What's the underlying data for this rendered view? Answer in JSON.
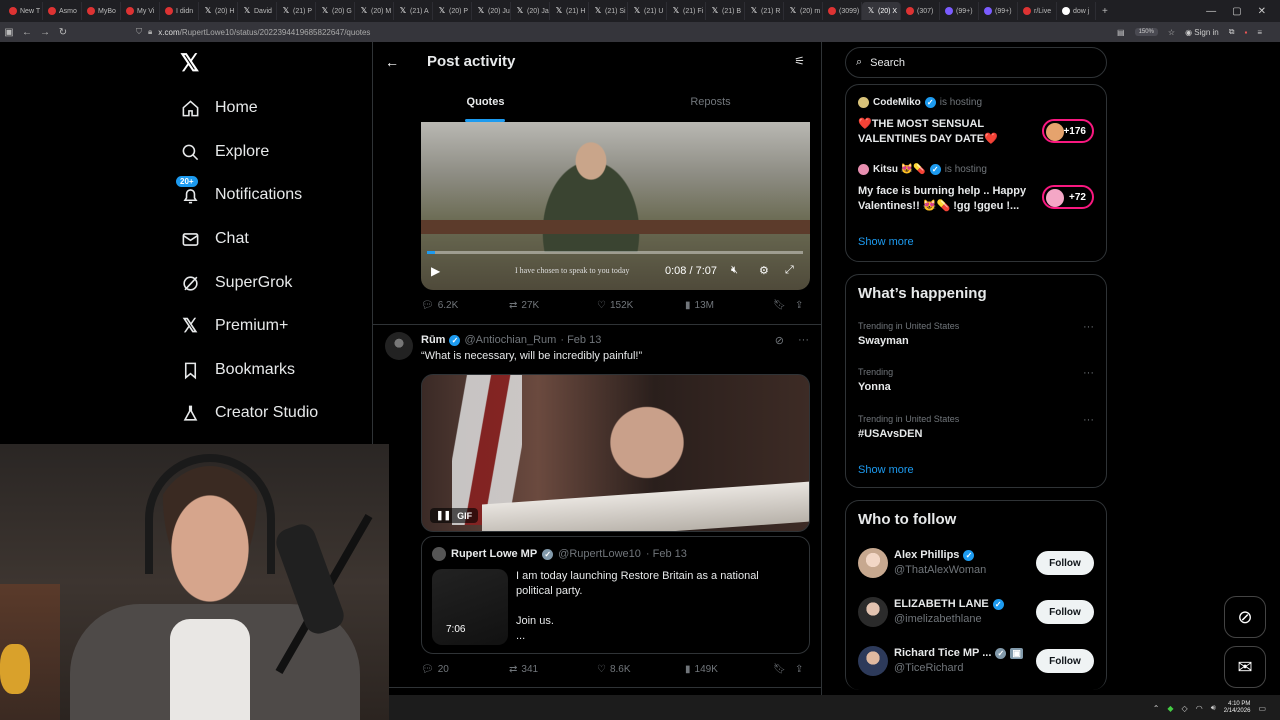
{
  "browser": {
    "tabs": [
      "New T",
      "Asmo",
      "MyBo",
      "My Vi",
      "I didn",
      "(20) H",
      "David",
      "(21) P",
      "(20) G",
      "(20) M",
      "(21) A",
      "(20) P",
      "(20) Ju",
      "(20) Ja",
      "(21) H",
      "(21) Si",
      "(21) U",
      "(21) Fi",
      "(21) B",
      "(21) R",
      "(20) m",
      "(3099)",
      "(20) X",
      "(307)",
      "(99+)",
      "(99+)",
      "r/Live",
      "dow j"
    ],
    "url_domain": "x.com",
    "url_path": "/RupertLowe10/status/2022394419685822647/quotes",
    "zoom": "150%",
    "sign_in": "Sign in"
  },
  "nav": {
    "items": [
      {
        "label": "Home",
        "icon": "home-icon"
      },
      {
        "label": "Explore",
        "icon": "search-icon"
      },
      {
        "label": "Notifications",
        "icon": "bell-icon",
        "badge": "20+"
      },
      {
        "label": "Chat",
        "icon": "mail-icon"
      },
      {
        "label": "SuperGrok",
        "icon": "grok-icon"
      },
      {
        "label": "Premium+",
        "icon": "x-icon"
      },
      {
        "label": "Bookmarks",
        "icon": "bookmark-icon"
      },
      {
        "label": "Creator Studio",
        "icon": "flask-icon"
      }
    ]
  },
  "header": {
    "title": "Post activity",
    "tabs": [
      "Quotes",
      "Reposts"
    ]
  },
  "post1": {
    "video_subtitle": "I have chosen to speak to you today",
    "time": "0:08 / 7:07",
    "progress": 0.02,
    "replies": "6.2K",
    "reposts": "27K",
    "likes": "152K",
    "views": "13M"
  },
  "post2": {
    "name": "Rūm",
    "handle": "@Antiochian_Rum",
    "date": "· Feb 13",
    "text": "“What is necessary, will be incredibly painful!”",
    "gif_label": "GIF",
    "quote": {
      "name": "Rupert Lowe MP",
      "handle": "@RupertLowe10",
      "date": "· Feb 13",
      "duration": "7:06",
      "line1": "I am today launching Restore Britain as a national political party.",
      "line2": "Join us.",
      "line3": "..."
    },
    "replies": "20",
    "reposts": "341",
    "likes": "8.6K",
    "views": "149K"
  },
  "right": {
    "search_placeholder": "Search",
    "live": [
      {
        "name": "CodeMiko",
        "status": "is hosting",
        "title": "❤️THE MOST SENSUAL VALENTINES DAY DATE❤️",
        "count": "+176"
      },
      {
        "name": "Kitsu 😻💊",
        "status": "is hosting",
        "title": "My face is burning help .. Happy Valentines!! 😻💊 !gg !ggeu !...",
        "count": "+72"
      }
    ],
    "show_more": "Show more",
    "happening_title": "What’s happening",
    "trends": [
      {
        "context": "Trending in United States",
        "name": "Swayman"
      },
      {
        "context": "Trending",
        "name": "Yonna"
      },
      {
        "context": "Trending in United States",
        "name": "#USAvsDEN"
      }
    ],
    "follow_title": "Who to follow",
    "follow": [
      {
        "name": "Alex Phillips",
        "handle": "@ThatAlexWoman",
        "button": "Follow"
      },
      {
        "name": "ELIZABETH LANE",
        "handle": "@imelizabethlane",
        "button": "Follow"
      },
      {
        "name": "Richard Tice MP ...",
        "handle": "@TiceRichard",
        "button": "Follow"
      }
    ]
  },
  "taskbar": {
    "time": "4:10 PM",
    "date": "2/14/2026"
  },
  "colors": {
    "accent": "#1d9bf0",
    "live_ring": "#f91880",
    "background": "#000000"
  }
}
